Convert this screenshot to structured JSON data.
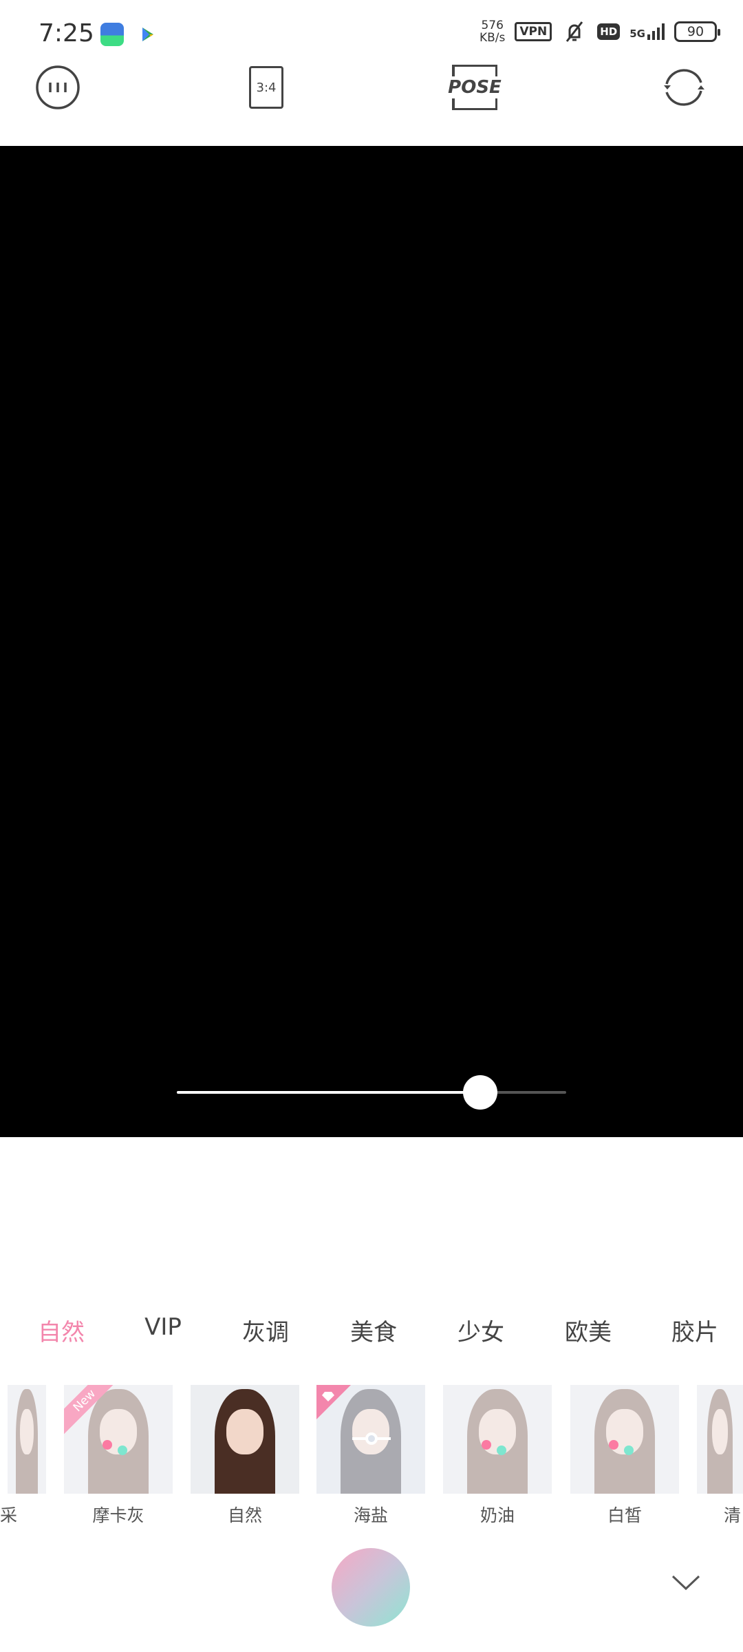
{
  "status_bar": {
    "time": "7:25",
    "net_speed_value": "576",
    "net_speed_unit": "KB/s",
    "vpn": "VPN",
    "hd": "HD",
    "network": "5G",
    "battery": "90"
  },
  "toolbar": {
    "menu_icon": "menu-circle-icon",
    "ratio_label": "3:4",
    "pose_label": "POSE",
    "switch_icon": "switch-camera-icon"
  },
  "zoom_slider": {
    "value_percent": 78
  },
  "filter_tabs": [
    {
      "label": "自然",
      "active": true
    },
    {
      "label": "VIP"
    },
    {
      "label": "灰调"
    },
    {
      "label": "美食"
    },
    {
      "label": "少女"
    },
    {
      "label": "欧美"
    },
    {
      "label": "胶片"
    }
  ],
  "filters": [
    {
      "label": "采",
      "partial": true
    },
    {
      "label": "摩卡灰",
      "badge": "New"
    },
    {
      "label": "自然",
      "selected": true
    },
    {
      "label": "海盐",
      "badge": "vip-diamond-icon"
    },
    {
      "label": "奶油"
    },
    {
      "label": "白皙"
    },
    {
      "label": "清",
      "partial": true
    }
  ],
  "colors": {
    "accent": "#f386ac",
    "preview_bg": "#000000"
  }
}
